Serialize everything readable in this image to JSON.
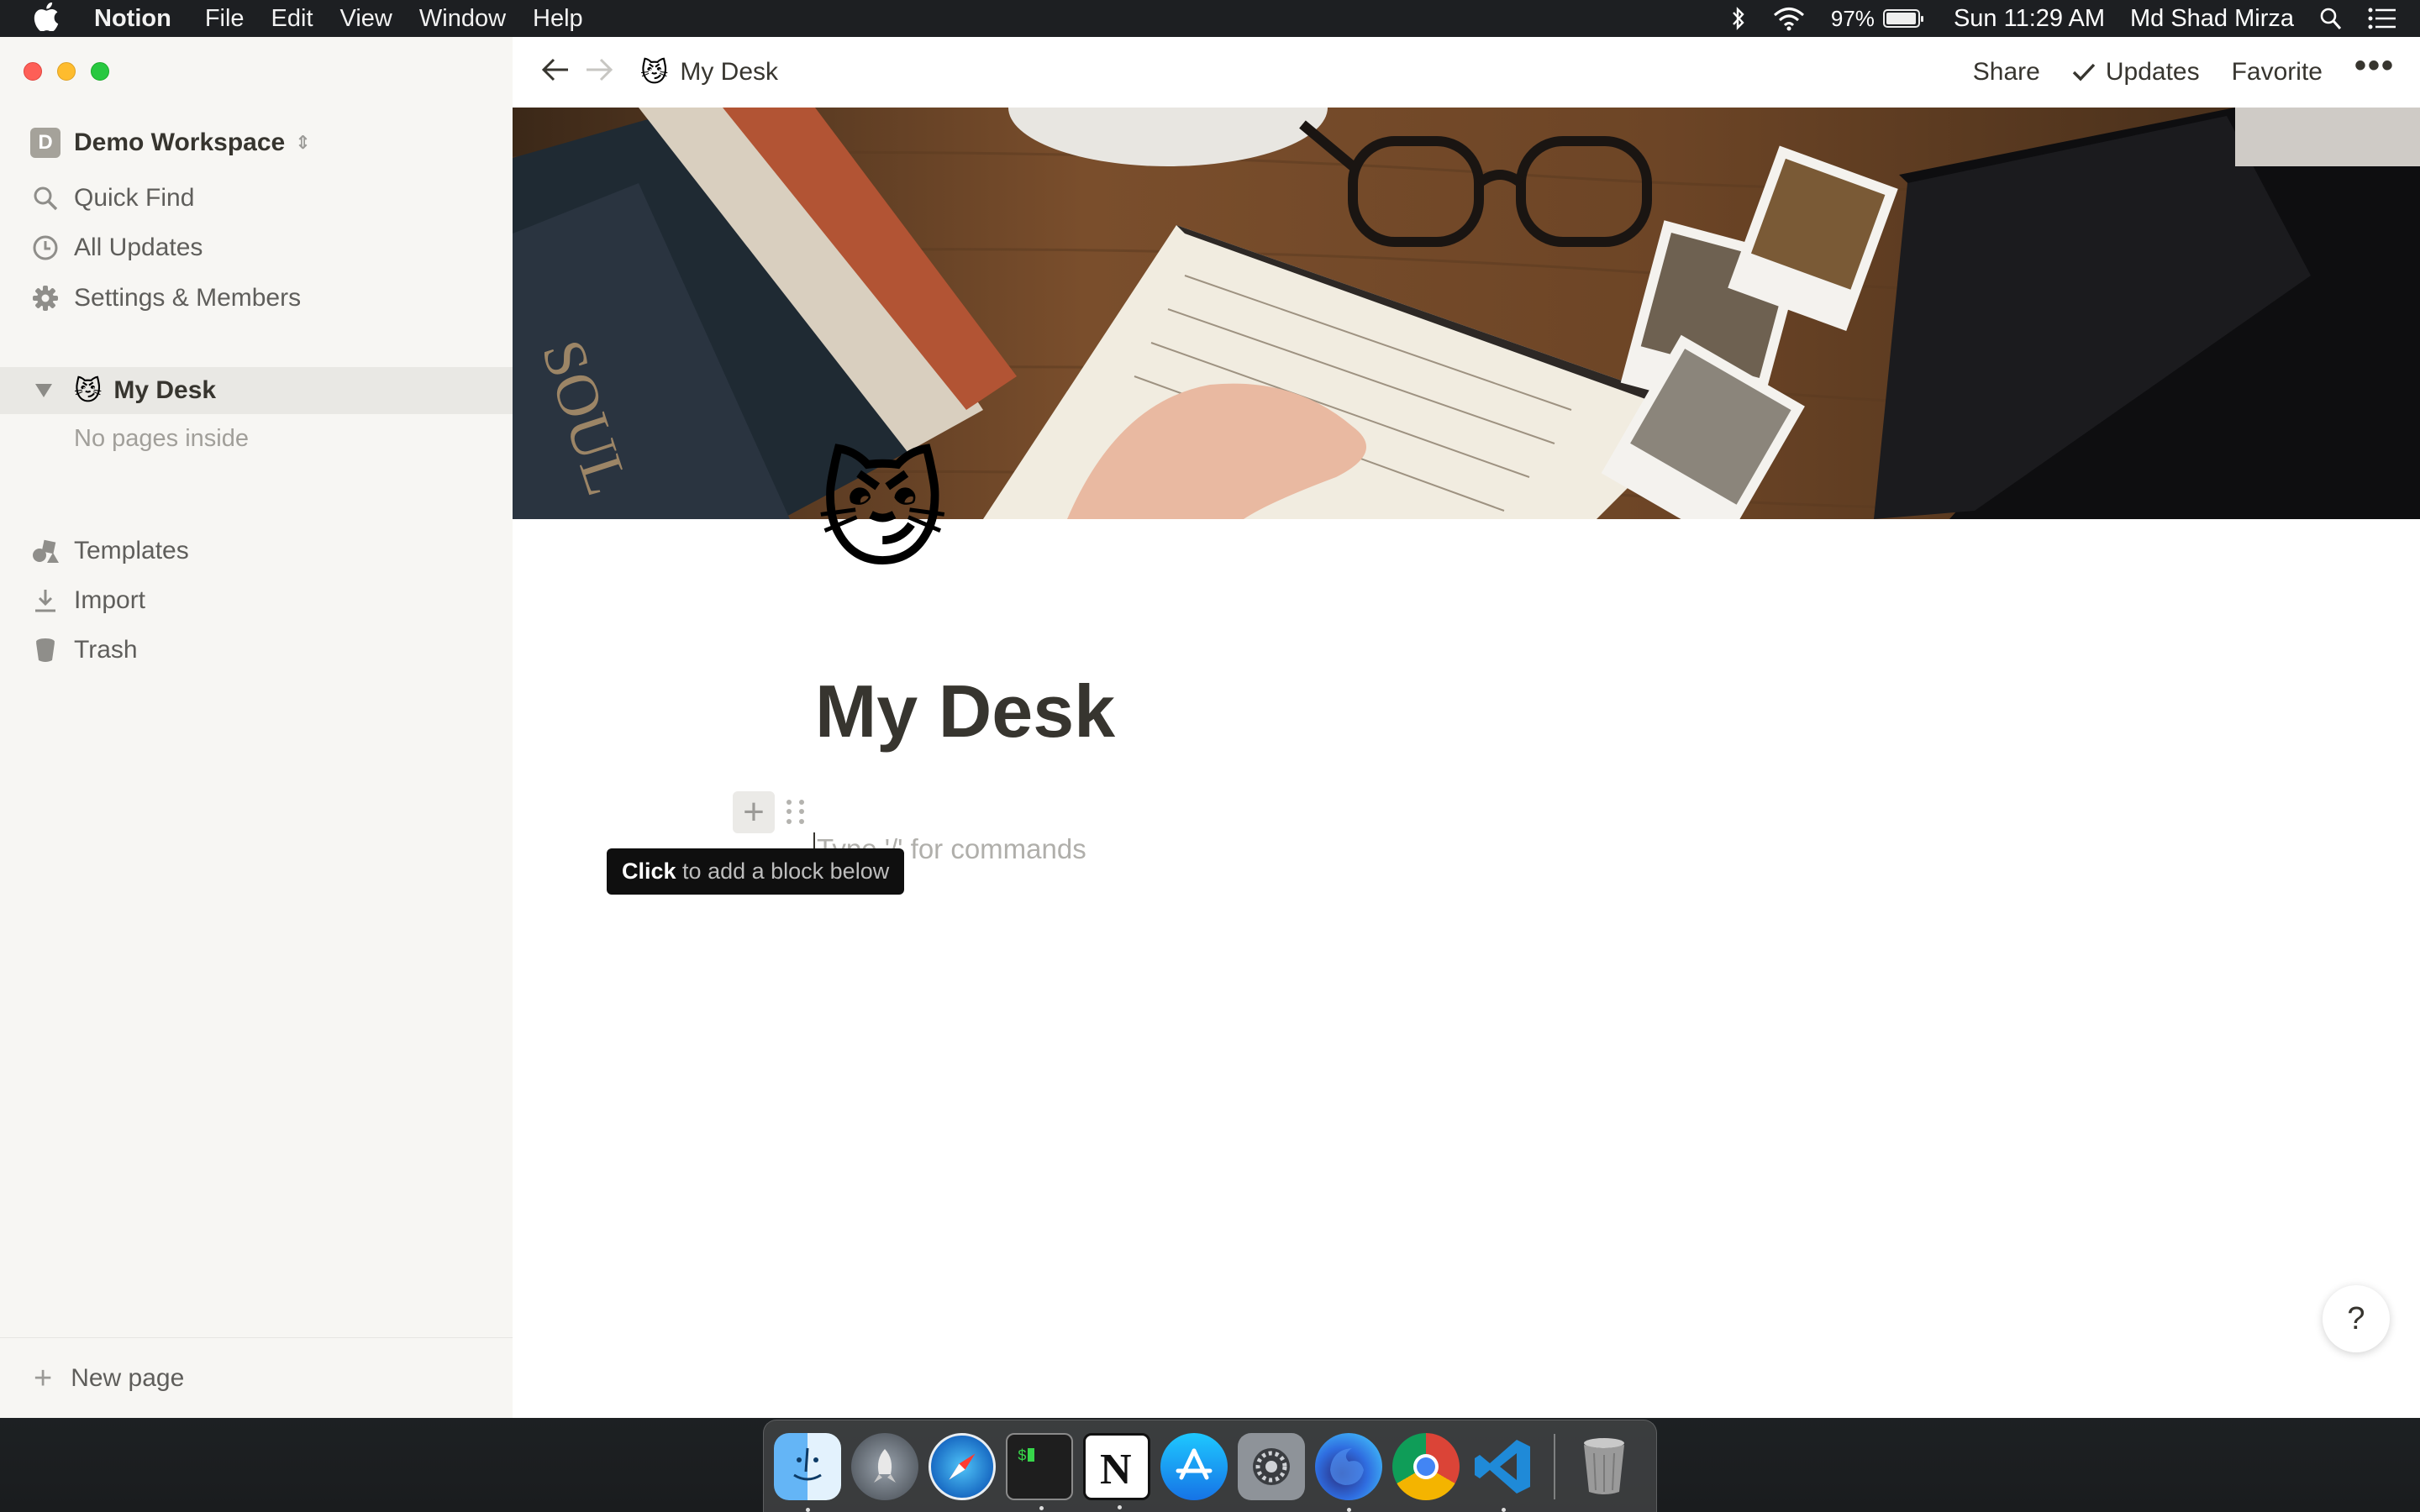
{
  "menubar": {
    "app_name": "Notion",
    "menus": [
      "File",
      "Edit",
      "View",
      "Window",
      "Help"
    ],
    "battery_percent": "97%",
    "battery_level": 0.97,
    "clock": "Sun 11:29 AM",
    "user": "Md Shad Mirza",
    "icons": [
      "apple-icon",
      "bluetooth-icon",
      "wifi-icon",
      "battery-icon",
      "spotlight-icon",
      "notification-center-icon"
    ]
  },
  "sidebar": {
    "workspace_initial": "D",
    "workspace_name": "Demo Workspace",
    "nav": [
      {
        "label": "Quick Find",
        "icon": "search-icon"
      },
      {
        "label": "All Updates",
        "icon": "clock-icon"
      },
      {
        "label": "Settings & Members",
        "icon": "gear-icon"
      }
    ],
    "page": {
      "emoji": "😼",
      "title": "My Desk"
    },
    "empty_text": "No pages inside",
    "tools": [
      {
        "label": "Templates",
        "icon": "templates-icon"
      },
      {
        "label": "Import",
        "icon": "import-icon"
      },
      {
        "label": "Trash",
        "icon": "trash-icon"
      }
    ],
    "new_page": "New page"
  },
  "topbar": {
    "crumb_emoji": "😼",
    "crumb_title": "My Desk",
    "share": "Share",
    "updates": "Updates",
    "favorite": "Favorite",
    "more": "•••"
  },
  "page": {
    "icon_emoji": "😼",
    "title": "My Desk",
    "placeholder": "Type '/' for commands",
    "add_block_icon": "+",
    "tooltip_bold": "Click",
    "tooltip_rest": " to add a block below",
    "help": "?"
  },
  "dock": {
    "apps": [
      "Finder",
      "Launchpad",
      "Safari",
      "Terminal",
      "Notion",
      "App Store",
      "System Preferences",
      "Firefox",
      "Chrome",
      "Visual Studio Code"
    ],
    "trash": "Trash"
  }
}
